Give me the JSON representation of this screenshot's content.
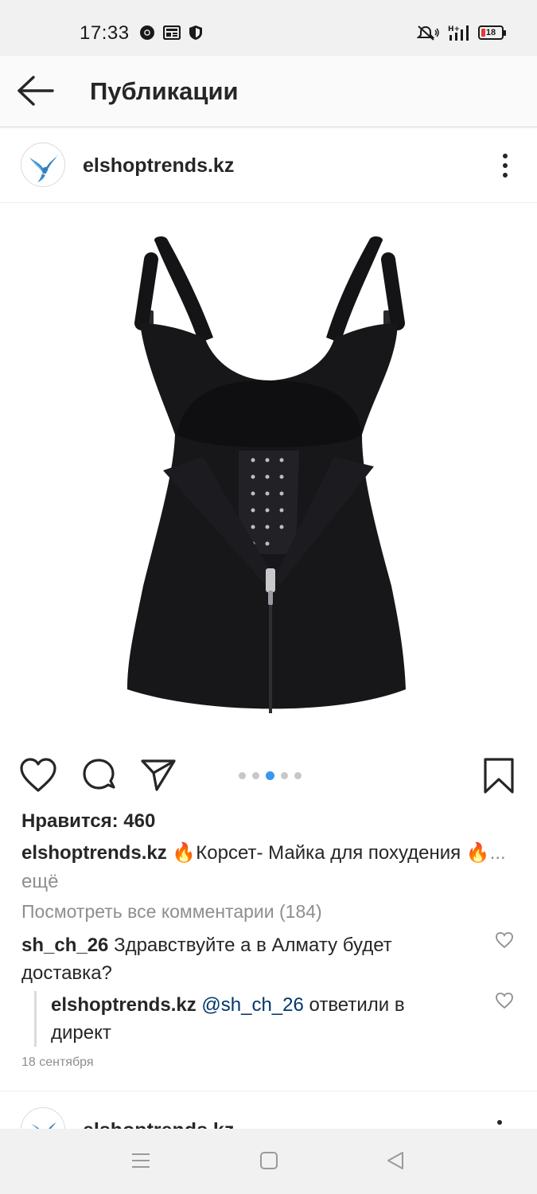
{
  "status_bar": {
    "time": "17:33",
    "battery": "18",
    "icons_left": [
      "chrome-icon",
      "news-icon",
      "shield-icon"
    ],
    "icons_right": [
      "mute-icon",
      "signal-icon",
      "battery-icon"
    ]
  },
  "nav": {
    "title": "Публикации",
    "back_icon": "arrow-left-icon"
  },
  "post": {
    "username": "elshoptrends.kz",
    "likes": "Нравится: 460",
    "caption_username": "elshoptrends.kz",
    "caption_text": "🔥Корсет- Майка для похудения 🔥",
    "caption_more": "... ещё",
    "view_comments": "Посмотреть все комментарии (184)",
    "carousel": {
      "count": 5,
      "active": 2
    },
    "comments": [
      {
        "username": "sh_ch_26",
        "text": "Здравствуйте а в Алмату будет доставка?"
      }
    ],
    "reply": {
      "username": "elshoptrends.kz",
      "mention": "@sh_ch_26",
      "text": "ответили в директ"
    },
    "date": "18 сентября"
  },
  "next_post": {
    "username": "elshoptrends.kz"
  },
  "colors": {
    "accent": "#3897f0",
    "mention": "#00376b",
    "muted": "#8e8e8e",
    "text": "#262626"
  }
}
